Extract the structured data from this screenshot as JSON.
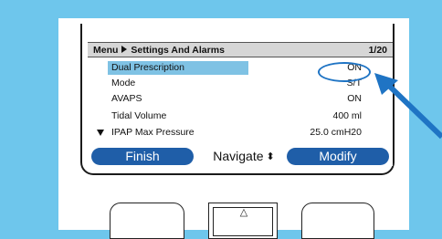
{
  "menu": {
    "title": "Menu",
    "section": "Settings And Alarms",
    "page": "1/20"
  },
  "rows": [
    {
      "label": "Dual Prescription",
      "value": "ON"
    },
    {
      "label": "Mode",
      "value": "S/T"
    },
    {
      "label": "AVAPS",
      "value": "ON"
    },
    {
      "label": "Tidal Volume",
      "value": "400 ml"
    },
    {
      "label": "IPAP Max Pressure",
      "value": "25.0 cmH20"
    }
  ],
  "softkeys": {
    "left": "Finish",
    "center": "Navigate",
    "right": "Modify"
  },
  "hardware": {
    "up_symbol": "△"
  },
  "colors": {
    "background": "#6ec6ec",
    "selection": "#7fc2e4",
    "softkey": "#1f5ea8",
    "callout": "#1f74c4"
  },
  "icons": {
    "breadcrumb": "right-triangle-icon",
    "scroll": "down-triangle-icon",
    "navigate": "up-down-arrow-icon",
    "pointer": "callout-arrow-icon"
  }
}
